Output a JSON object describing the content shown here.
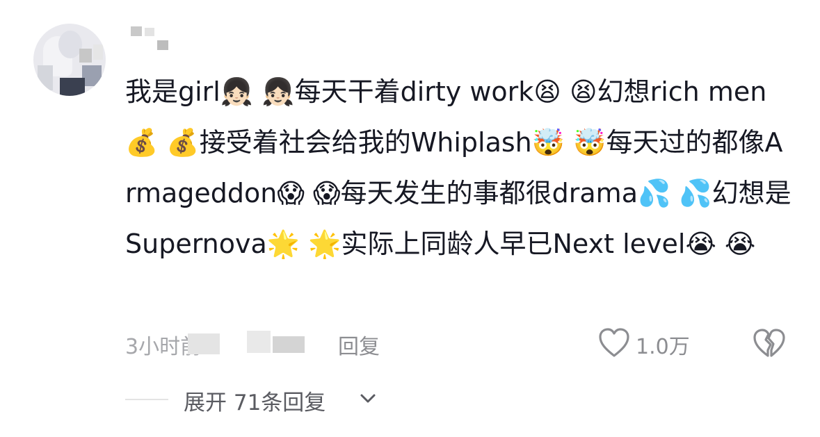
{
  "comment": {
    "text": "我是girl👧🏻 👧🏻每天干着dirty work😫 😫幻想rich men💰 💰接受着社会给我的Whiplash🤯 🤯每天过的都像Armageddon😱 😱每天发生的事都很drama💦 💦幻想是Supernova🌟 🌟实际上同龄人早已Next level😭 😭"
  },
  "meta": {
    "time": "3小时前",
    "reply_label": "回复",
    "like_count": "1.0万"
  },
  "expand": {
    "label": "展开 71条回复"
  },
  "icons": {
    "heart": "heart-outline-icon",
    "dislike": "broken-heart-icon",
    "chevron": "chevron-down-icon"
  },
  "colors": {
    "text": "#161823",
    "muted": "#a6a7ab",
    "secondary": "#8c8d91"
  }
}
